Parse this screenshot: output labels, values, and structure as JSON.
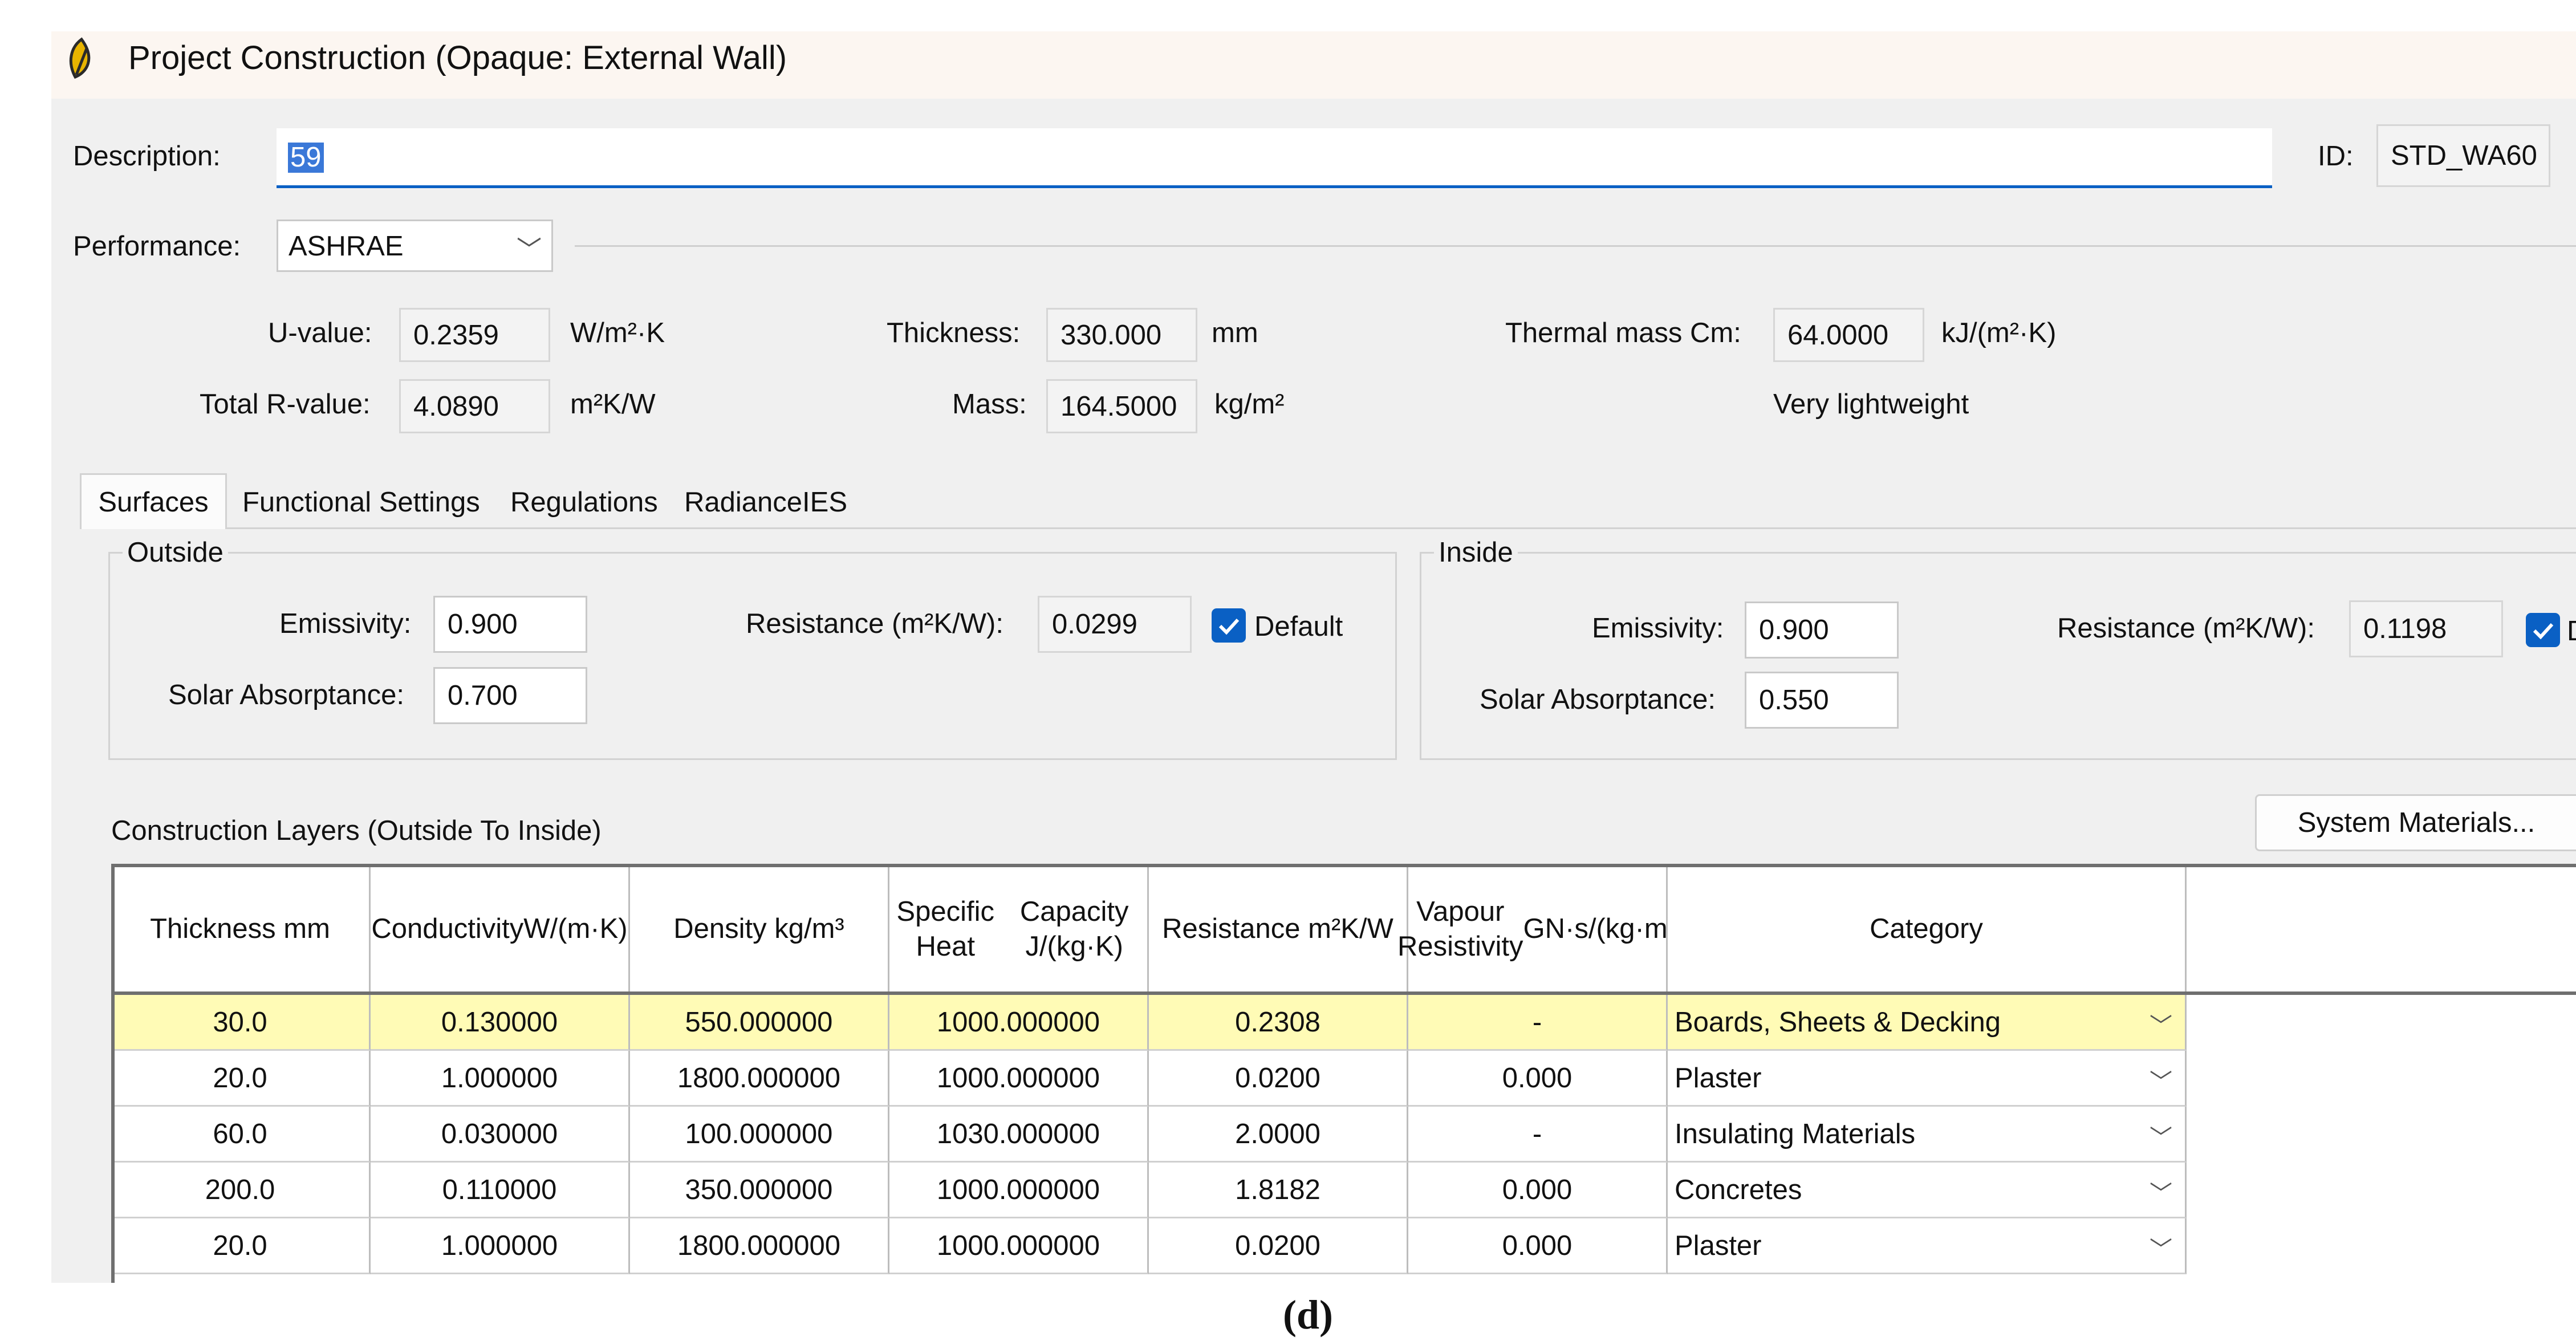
{
  "window": {
    "title": "Project Construction (Opaque: External Wall)",
    "icon": "app-leaf-icon"
  },
  "description": {
    "label": "Description:",
    "value": "59"
  },
  "id": {
    "label": "ID:",
    "value": "STD_WA60"
  },
  "performance": {
    "label": "Performance:",
    "value": "ASHRAE"
  },
  "metrics": {
    "u_value_label": "U-value:",
    "u_value": "0.2359",
    "u_value_unit": "W/m²·K",
    "total_r_label": "Total R-value:",
    "total_r": "4.0890",
    "total_r_unit": "m²K/W",
    "thickness_label": "Thickness:",
    "thickness": "330.000",
    "thickness_unit": "mm",
    "mass_label": "Mass:",
    "mass": "164.5000",
    "mass_unit": "kg/m²",
    "thermal_mass_label": "Thermal mass Cm:",
    "thermal_mass": "64.0000",
    "thermal_mass_unit": "kJ/(m²·K)",
    "weight_class": "Very lightweight"
  },
  "tabs": [
    "Surfaces",
    "Functional Settings",
    "Regulations",
    "RadianceIES"
  ],
  "outside": {
    "legend": "Outside",
    "emissivity_label": "Emissivity:",
    "emissivity": "0.900",
    "solar_label": "Solar Absorptance:",
    "solar": "0.700",
    "resistance_label": "Resistance (m²K/W):",
    "resistance": "0.0299",
    "default_label": "Default"
  },
  "inside": {
    "legend": "Inside",
    "emissivity_label": "Emissivity:",
    "emissivity": "0.900",
    "solar_label": "Solar Absorptance:",
    "solar": "0.550",
    "resistance_label": "Resistance (m²K/W):",
    "resistance": "0.1198",
    "default_label": "D"
  },
  "layers": {
    "title": "Construction Layers (Outside To Inside)",
    "system_materials_button": "System Materials...",
    "columns": [
      [
        "Thickness mm"
      ],
      [
        "Conductivity",
        "W/(m·K)"
      ],
      [
        "Density kg/m³"
      ],
      [
        "Specific Heat",
        "Capacity J/(kg·K)"
      ],
      [
        "Resistance m²K/W"
      ],
      [
        "Vapour Resistivity",
        "GN·s/(kg·m)"
      ],
      [
        "Category"
      ]
    ],
    "rows": [
      [
        "30.0",
        "0.130000",
        "550.000000",
        "1000.000000",
        "0.2308",
        "-",
        "Boards, Sheets & Decking"
      ],
      [
        "20.0",
        "1.000000",
        "1800.000000",
        "1000.000000",
        "0.0200",
        "0.000",
        "Plaster"
      ],
      [
        "60.0",
        "0.030000",
        "100.000000",
        "1030.000000",
        "2.0000",
        "-",
        "Insulating Materials"
      ],
      [
        "200.0",
        "0.110000",
        "350.000000",
        "1000.000000",
        "1.8182",
        "0.000",
        "Concretes"
      ],
      [
        "20.0",
        "1.000000",
        "1800.000000",
        "1000.000000",
        "0.0200",
        "0.000",
        "Plaster"
      ]
    ],
    "selected_row_color": "#fffbb6"
  },
  "caption": "(d)",
  "colors": {
    "accent": "#0a60c4",
    "title_bg": "#fcf6f1",
    "panel_bg": "#f0f0f0"
  }
}
